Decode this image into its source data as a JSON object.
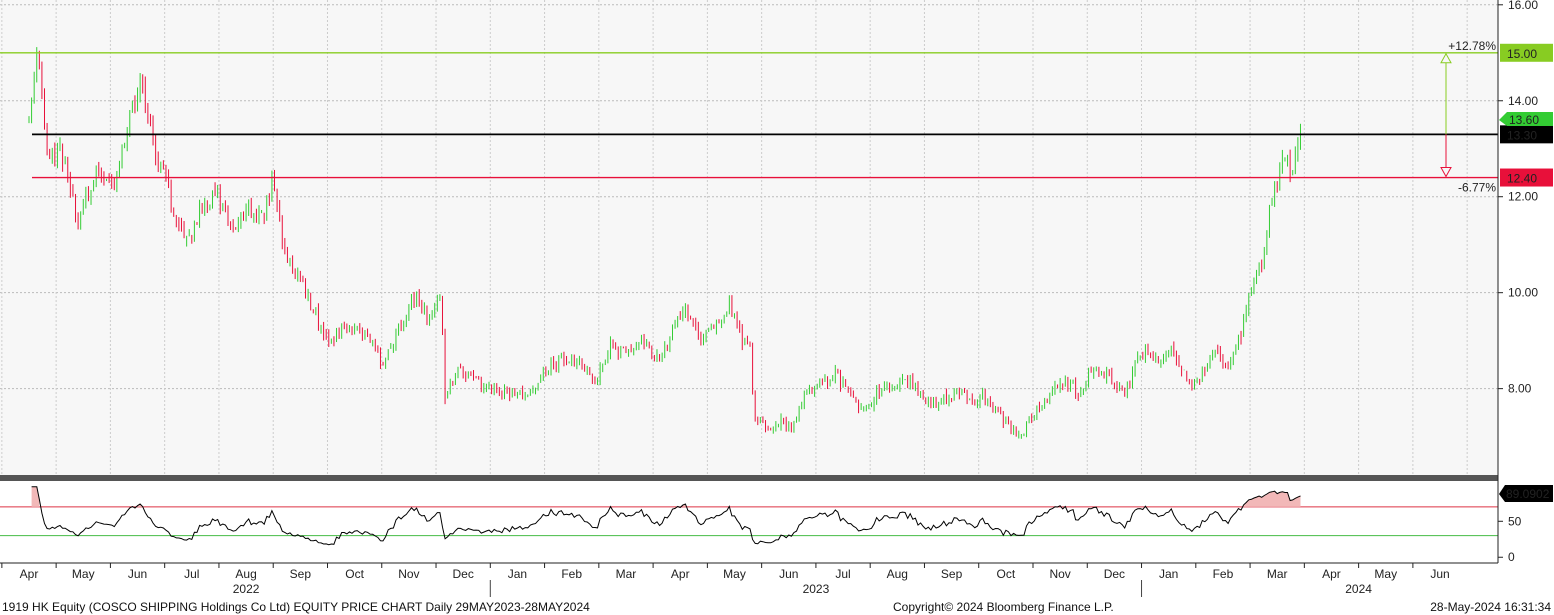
{
  "footer": {
    "left": "1919 HK Equity (COSCO SHIPPING Holdings Co Ltd) EQUITY PRICE CHART  Daily 29MAY2023-28MAY2024",
    "center": "Copyright© 2024 Bloomberg Finance L.P.",
    "right": "28-May-2024 16:31:34"
  },
  "colors": {
    "up": "#33cc33",
    "down": "#e8103a",
    "resistance": "#88cc22",
    "pivot": "#000000",
    "support": "#e8103a",
    "rsi_line": "#000000",
    "rsi_fill": "#f2b8b8"
  },
  "chart_data": [
    {
      "type": "candlestick",
      "title": "",
      "y_axis_ticks": [
        "16.00",
        "14.00",
        "12.00",
        "10.00",
        "8.00"
      ],
      "ylim": [
        6.2,
        16.1
      ],
      "x_month_labels": [
        "Apr",
        "May",
        "Jun",
        "Jul",
        "Aug",
        "Sep",
        "Oct",
        "Nov",
        "Dec",
        "Jan",
        "Feb",
        "Mar",
        "Apr",
        "May",
        "Jun",
        "Jul",
        "Aug",
        "Sep",
        "Oct",
        "Nov",
        "Dec",
        "Jan",
        "Feb",
        "Mar",
        "Apr",
        "May",
        "Jun"
      ],
      "x_year_labels": [
        "2022",
        "2023",
        "2024"
      ],
      "price_anchors": [
        {
          "m": 0.0,
          "v": 13.8
        },
        {
          "m": 0.15,
          "v": 15.0
        },
        {
          "m": 0.35,
          "v": 12.8
        },
        {
          "m": 0.55,
          "v": 13.1
        },
        {
          "m": 0.9,
          "v": 11.5
        },
        {
          "m": 1.3,
          "v": 12.6
        },
        {
          "m": 1.55,
          "v": 12.2
        },
        {
          "m": 1.9,
          "v": 13.8
        },
        {
          "m": 2.1,
          "v": 14.5
        },
        {
          "m": 2.25,
          "v": 13.2
        },
        {
          "m": 2.5,
          "v": 12.5
        },
        {
          "m": 2.65,
          "v": 11.6
        },
        {
          "m": 2.9,
          "v": 11.0
        },
        {
          "m": 3.2,
          "v": 11.8
        },
        {
          "m": 3.45,
          "v": 12.1
        },
        {
          "m": 3.75,
          "v": 11.2
        },
        {
          "m": 4.0,
          "v": 11.8
        },
        {
          "m": 4.3,
          "v": 11.6
        },
        {
          "m": 4.5,
          "v": 12.4
        },
        {
          "m": 4.7,
          "v": 10.8
        },
        {
          "m": 5.0,
          "v": 10.3
        },
        {
          "m": 5.3,
          "v": 9.5
        },
        {
          "m": 5.5,
          "v": 9.0
        },
        {
          "m": 5.9,
          "v": 9.3
        },
        {
          "m": 6.2,
          "v": 9.1
        },
        {
          "m": 6.55,
          "v": 8.5
        },
        {
          "m": 6.9,
          "v": 9.5
        },
        {
          "m": 7.1,
          "v": 9.9
        },
        {
          "m": 7.35,
          "v": 9.5
        },
        {
          "m": 7.6,
          "v": 9.9
        },
        {
          "m": 7.65,
          "v": 7.8
        },
        {
          "m": 7.9,
          "v": 8.4
        },
        {
          "m": 8.3,
          "v": 8.1
        },
        {
          "m": 8.6,
          "v": 8.0
        },
        {
          "m": 8.9,
          "v": 7.9
        },
        {
          "m": 9.3,
          "v": 7.9
        },
        {
          "m": 9.6,
          "v": 8.5
        },
        {
          "m": 10.0,
          "v": 8.6
        },
        {
          "m": 10.45,
          "v": 8.2
        },
        {
          "m": 10.7,
          "v": 8.9
        },
        {
          "m": 11.0,
          "v": 8.7
        },
        {
          "m": 11.35,
          "v": 9.0
        },
        {
          "m": 11.6,
          "v": 8.6
        },
        {
          "m": 11.9,
          "v": 9.3
        },
        {
          "m": 12.1,
          "v": 9.8
        },
        {
          "m": 12.35,
          "v": 9.0
        },
        {
          "m": 12.7,
          "v": 9.4
        },
        {
          "m": 12.9,
          "v": 9.7
        },
        {
          "m": 13.15,
          "v": 9.0
        },
        {
          "m": 13.3,
          "v": 8.8
        },
        {
          "m": 13.35,
          "v": 7.4
        },
        {
          "m": 13.6,
          "v": 7.2
        },
        {
          "m": 13.85,
          "v": 7.3
        },
        {
          "m": 14.05,
          "v": 7.2
        },
        {
          "m": 14.3,
          "v": 7.9
        },
        {
          "m": 14.6,
          "v": 8.1
        },
        {
          "m": 14.85,
          "v": 8.3
        },
        {
          "m": 15.2,
          "v": 7.8
        },
        {
          "m": 15.4,
          "v": 7.5
        },
        {
          "m": 15.7,
          "v": 8.0
        },
        {
          "m": 16.0,
          "v": 8.1
        },
        {
          "m": 16.25,
          "v": 8.2
        },
        {
          "m": 16.55,
          "v": 7.7
        },
        {
          "m": 16.9,
          "v": 7.8
        },
        {
          "m": 17.2,
          "v": 8.0
        },
        {
          "m": 17.45,
          "v": 7.7
        },
        {
          "m": 17.6,
          "v": 7.9
        },
        {
          "m": 17.9,
          "v": 7.4
        },
        {
          "m": 18.3,
          "v": 7.0
        },
        {
          "m": 18.55,
          "v": 7.6
        },
        {
          "m": 18.9,
          "v": 8.0
        },
        {
          "m": 19.1,
          "v": 8.2
        },
        {
          "m": 19.35,
          "v": 7.9
        },
        {
          "m": 19.6,
          "v": 8.4
        },
        {
          "m": 19.95,
          "v": 8.2
        },
        {
          "m": 20.2,
          "v": 7.8
        },
        {
          "m": 20.4,
          "v": 8.6
        },
        {
          "m": 20.6,
          "v": 8.8
        },
        {
          "m": 20.85,
          "v": 8.5
        },
        {
          "m": 21.05,
          "v": 8.8
        },
        {
          "m": 21.3,
          "v": 8.3
        },
        {
          "m": 21.5,
          "v": 8.1
        },
        {
          "m": 21.8,
          "v": 8.7
        },
        {
          "m": 22.1,
          "v": 8.5
        },
        {
          "m": 22.3,
          "v": 9.0
        },
        {
          "m": 22.5,
          "v": 10.0
        },
        {
          "m": 22.7,
          "v": 10.6
        },
        {
          "m": 22.85,
          "v": 11.6
        },
        {
          "m": 23.05,
          "v": 12.5
        },
        {
          "m": 23.15,
          "v": 12.8
        },
        {
          "m": 23.3,
          "v": 12.5
        },
        {
          "m": 23.45,
          "v": 13.6
        }
      ],
      "last_price": "13.60",
      "levels": [
        {
          "name": "resistance",
          "value": "15.00",
          "pct": "+12.78%"
        },
        {
          "name": "pivot",
          "value": "13.30"
        },
        {
          "name": "support",
          "value": "12.40",
          "pct": "-6.77%"
        }
      ]
    },
    {
      "type": "line",
      "title": "",
      "y_axis_ticks": [
        "50",
        "0"
      ],
      "ylim": [
        -8,
        106
      ],
      "overbought": 70,
      "oversold": 30,
      "last_value": "89.0902"
    }
  ]
}
